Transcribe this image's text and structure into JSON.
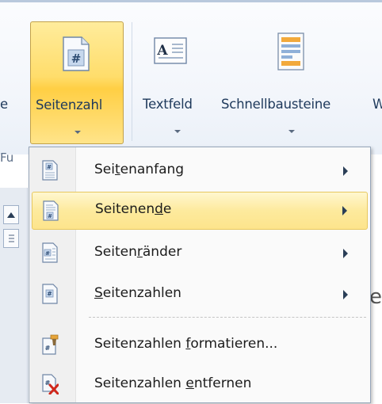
{
  "ribbon": {
    "cut_left_label": "e",
    "seitenzahl_label": "Seitenzahl",
    "textfeld_label": "Textfeld",
    "schnellbausteine_label": "Schnellbausteine",
    "cut_right_label": "W",
    "group_cut_label": "Fu"
  },
  "menu": {
    "items": [
      {
        "pre": "Sei",
        "ul": "t",
        "post": "enanfang",
        "submenu": true,
        "highlighted": false
      },
      {
        "pre": "Seitenen",
        "ul": "d",
        "post": "e",
        "submenu": true,
        "highlighted": true
      },
      {
        "pre": "Seiten",
        "ul": "r",
        "post": "änder",
        "submenu": true,
        "highlighted": false
      },
      {
        "pre": "",
        "ul": "S",
        "post": "eitenzahlen",
        "submenu": true,
        "highlighted": false
      },
      {
        "pre": "Seitenzahlen ",
        "ul": "f",
        "post": "ormatieren...",
        "submenu": false,
        "highlighted": false
      },
      {
        "pre": "Seitenzahlen ",
        "ul": "e",
        "post": "ntfernen",
        "submenu": false,
        "highlighted": false
      }
    ]
  },
  "doc": {
    "peek_char": "e"
  },
  "colors": {
    "highlight": "#fde48c",
    "accent_text": "#1e395b",
    "remove_x": "#d0281c"
  }
}
